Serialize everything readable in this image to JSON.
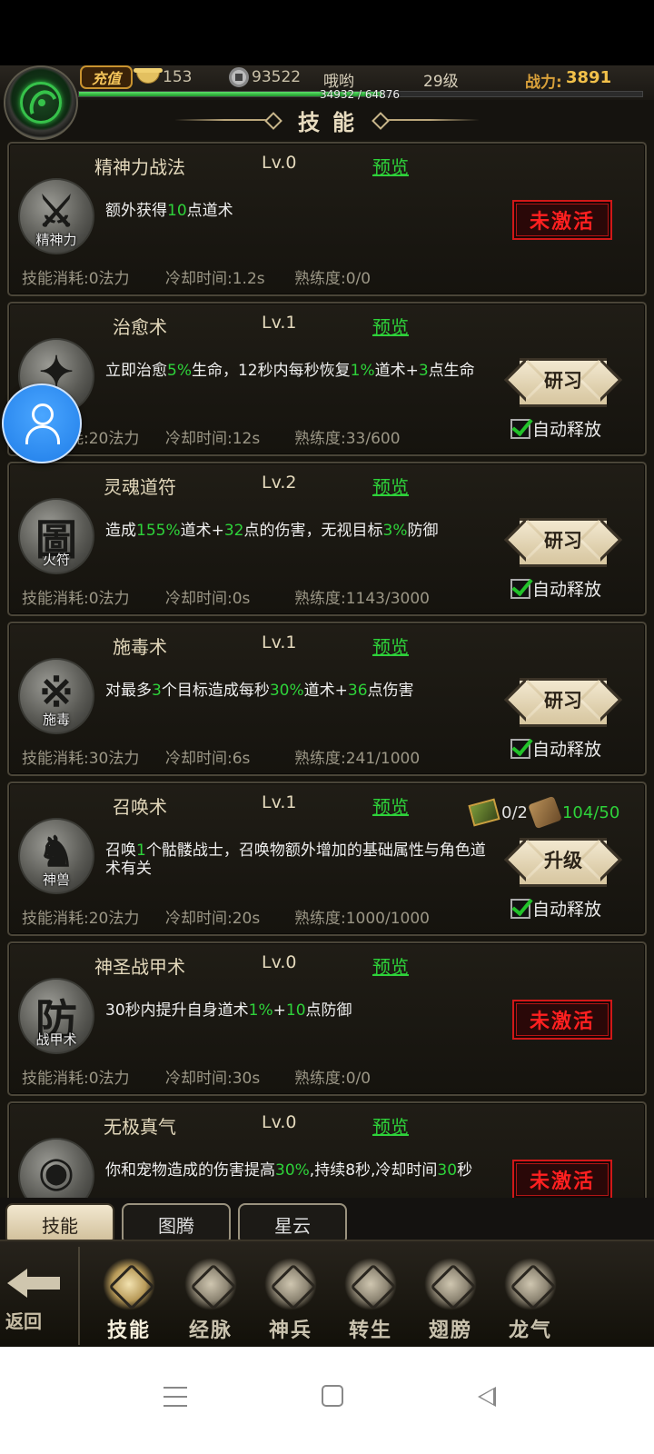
{
  "top": {
    "recharge_label": "充值",
    "ingots": "153",
    "coins": "93522",
    "player_name": "哦哟",
    "level": "29级",
    "power_label": "战力:",
    "power_value": "3891",
    "exp_text": "34932 / 64876",
    "exp_fraction": 0.538
  },
  "header": {
    "title": "技能"
  },
  "skills": [
    {
      "name": "精神力战法",
      "level": "Lv.0",
      "preview": "预览",
      "icon": "sword-icon",
      "icon_glyph": "⚔",
      "icon_tag": "精神力",
      "desc": [
        [
          "额外获得",
          0
        ],
        [
          "10",
          1
        ],
        [
          "点道术",
          0
        ]
      ],
      "cost": "技能消耗:0法力",
      "cooldown": "冷却时间:1.2s",
      "proficiency": "熟练度:0/0",
      "action": "inactive",
      "action_label": "未激活"
    },
    {
      "name": "治愈术",
      "level": "Lv.1",
      "preview": "预览",
      "icon": "sparkle-icon",
      "icon_glyph": "✦",
      "icon_tag": "",
      "desc": [
        [
          "立即治愈",
          0
        ],
        [
          "5%",
          1
        ],
        [
          "生命，12秒内每秒恢复",
          0
        ],
        [
          "1%",
          1
        ],
        [
          "道术+",
          0
        ],
        [
          "3",
          1
        ],
        [
          "点生命",
          0
        ]
      ],
      "cost": "技能消耗:20法力",
      "cooldown": "冷却时间:12s",
      "proficiency": "熟练度:33/600",
      "action": "study",
      "action_label": "研习",
      "auto_label": "自动释放"
    },
    {
      "name": "灵魂道符",
      "level": "Lv.2",
      "preview": "预览",
      "icon": "talisman-icon",
      "icon_glyph": "圖",
      "icon_tag": "火符",
      "desc": [
        [
          "造成",
          0
        ],
        [
          "155%",
          1
        ],
        [
          "道术+",
          0
        ],
        [
          "32",
          1
        ],
        [
          "点的伤害，无视目标",
          0
        ],
        [
          "3%",
          1
        ],
        [
          "防御",
          0
        ]
      ],
      "cost": "技能消耗:0法力",
      "cooldown": "冷却时间:0s",
      "proficiency": "熟练度:1143/3000",
      "action": "study",
      "action_label": "研习",
      "auto_label": "自动释放"
    },
    {
      "name": "施毒术",
      "level": "Lv.1",
      "preview": "预览",
      "icon": "poison-icon",
      "icon_glyph": "※",
      "icon_tag": "施毒",
      "desc": [
        [
          "对最多",
          0
        ],
        [
          "3",
          1
        ],
        [
          "个目标造成每秒",
          0
        ],
        [
          "30%",
          1
        ],
        [
          "道术+",
          0
        ],
        [
          "36",
          1
        ],
        [
          "点伤害",
          0
        ]
      ],
      "cost": "技能消耗:30法力",
      "cooldown": "冷却时间:6s",
      "proficiency": "熟练度:241/1000",
      "action": "study",
      "action_label": "研习",
      "auto_label": "自动释放"
    },
    {
      "name": "召唤术",
      "level": "Lv.1",
      "preview": "预览",
      "icon": "beast-icon",
      "icon_glyph": "♞",
      "icon_tag": "神兽",
      "desc": [
        [
          "召唤",
          0
        ],
        [
          "1",
          1
        ],
        [
          "个骷髅战士，召唤物额外增加的基础属性与角色道术有关",
          0
        ]
      ],
      "cost": "技能消耗:20法力",
      "cooldown": "冷却时间:20s",
      "proficiency": "熟练度:1000/1000",
      "action": "upgrade",
      "action_label": "升级",
      "auto_label": "自动释放",
      "materials": {
        "book": "0/2",
        "scroll": "104/50"
      }
    },
    {
      "name": "神圣战甲术",
      "level": "Lv.0",
      "preview": "预览",
      "icon": "armor-icon",
      "icon_glyph": "防",
      "icon_tag": "战甲术",
      "desc": [
        [
          "30秒内提升自身道术",
          0
        ],
        [
          "1%",
          1
        ],
        [
          "+",
          0
        ],
        [
          "10",
          1
        ],
        [
          "点防御",
          0
        ]
      ],
      "cost": "技能消耗:0法力",
      "cooldown": "冷却时间:30s",
      "proficiency": "熟练度:0/0",
      "action": "inactive",
      "action_label": "未激活"
    },
    {
      "name": "无极真气",
      "level": "Lv.0",
      "preview": "预览",
      "icon": "eye-icon",
      "icon_glyph": "◉",
      "icon_tag": "",
      "desc": [
        [
          "你和宠物造成的伤害提高",
          0
        ],
        [
          "30%",
          1
        ],
        [
          ",持续8秒,冷却时间",
          0
        ],
        [
          "30",
          1
        ],
        [
          "秒",
          0
        ]
      ],
      "cost": "",
      "cooldown": "",
      "proficiency": "",
      "action": "inactive",
      "action_label": "未激活"
    }
  ],
  "tabs": [
    "技能",
    "图腾",
    "星云"
  ],
  "nav": {
    "back_label": "返回",
    "items": [
      {
        "label": "技能",
        "icon": "skill-emblem-icon"
      },
      {
        "label": "经脉",
        "icon": "meridian-icon"
      },
      {
        "label": "神兵",
        "icon": "helmet-icon"
      },
      {
        "label": "转生",
        "icon": "rebirth-icon"
      },
      {
        "label": "翅膀",
        "icon": "wings-icon"
      },
      {
        "label": "龙气",
        "icon": "dragon-icon"
      }
    ]
  },
  "colors": {
    "accent_green": "#2ed23a",
    "inactive_red": "#ff2020",
    "gold": "#f2c14a"
  }
}
